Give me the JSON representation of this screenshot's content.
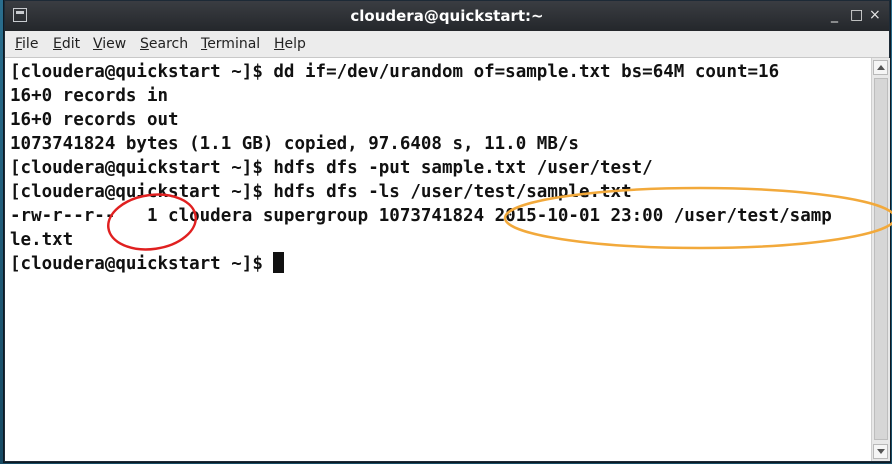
{
  "window": {
    "title": "cloudera@quickstart:~",
    "minimize_symbol": "_",
    "maximize_symbol": "□",
    "close_symbol": "×"
  },
  "menu": [
    "File",
    "Edit",
    "View",
    "Search",
    "Terminal",
    "Help"
  ],
  "terminal": {
    "lines": [
      "[cloudera@quickstart ~]$ dd if=/dev/urandom of=sample.txt bs=64M count=16",
      "16+0 records in",
      "16+0 records out",
      "1073741824 bytes (1.1 GB) copied, 97.6408 s, 11.0 MB/s",
      "[cloudera@quickstart ~]$ hdfs dfs -put sample.txt /user/test/",
      "[cloudera@quickstart ~]$ hdfs dfs -ls /user/test/sample.txt",
      "-rw-r--r--   1 cloudera supergroup 1073741824 2015-10-01 23:00 /user/test/samp",
      "le.txt",
      "[cloudera@quickstart ~]$ "
    ]
  },
  "colors": {
    "highlight_replication": "#e02020",
    "highlight_timestamp": "#f2a93b"
  }
}
